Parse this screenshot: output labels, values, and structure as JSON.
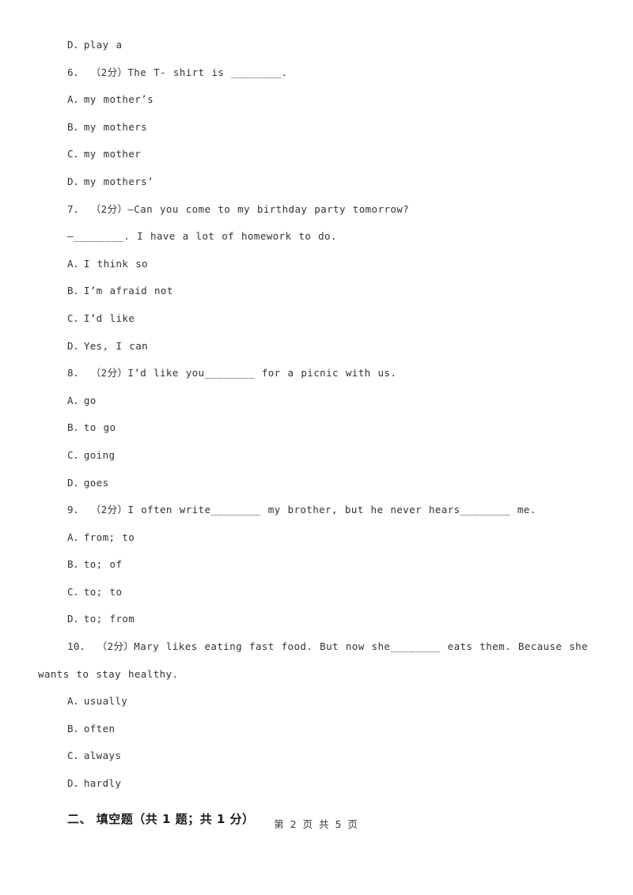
{
  "document": {
    "page_footer": "第 2 页 共 5 页",
    "page_number": "2",
    "total_pages": "5"
  },
  "body_lines": [
    {
      "kind": "option",
      "text": "D．play a"
    },
    {
      "kind": "question",
      "text": "6． （2分）The T- shirt is ________."
    },
    {
      "kind": "option",
      "text": "A．my mother’s"
    },
    {
      "kind": "option",
      "text": "B．my mothers"
    },
    {
      "kind": "option",
      "text": "C．my mother"
    },
    {
      "kind": "option",
      "text": "D．my mothers’"
    },
    {
      "kind": "question",
      "text": "7． （2分）—Can you come to my birthday party tomorrow?"
    },
    {
      "kind": "question",
      "text": "—________. I have a lot of homework to do."
    },
    {
      "kind": "option",
      "text": "A．I think so"
    },
    {
      "kind": "option",
      "text": "B．I’m afraid not"
    },
    {
      "kind": "option",
      "text": "C．I’d like"
    },
    {
      "kind": "option",
      "text": "D．Yes, I can"
    },
    {
      "kind": "question",
      "text": "8． （2分）I’d like you________ for a picnic with us."
    },
    {
      "kind": "option",
      "text": "A．go"
    },
    {
      "kind": "option",
      "text": "B．to go"
    },
    {
      "kind": "option",
      "text": "C．going"
    },
    {
      "kind": "option",
      "text": "D．goes"
    },
    {
      "kind": "question",
      "text": "9． （2分）I often write________ my brother, but he never hears________ me."
    },
    {
      "kind": "option",
      "text": "A．from; to"
    },
    {
      "kind": "option",
      "text": "B．to; of"
    },
    {
      "kind": "option",
      "text": "C．to; to"
    },
    {
      "kind": "option",
      "text": "D．to; from"
    },
    {
      "kind": "question-wrap",
      "text": "10． （2分）Mary likes eating fast food. But now she________ eats them. Because she wants to stay healthy."
    },
    {
      "kind": "option",
      "text": "A．usually"
    },
    {
      "kind": "option",
      "text": "B．often"
    },
    {
      "kind": "option",
      "text": "C．always"
    },
    {
      "kind": "option",
      "text": "D．hardly"
    }
  ],
  "section_header": {
    "text": "二、 填空题（共 1 题；共 1 分）",
    "number": "二",
    "title": "填空题",
    "count": "共 1 题；共 1 分"
  }
}
